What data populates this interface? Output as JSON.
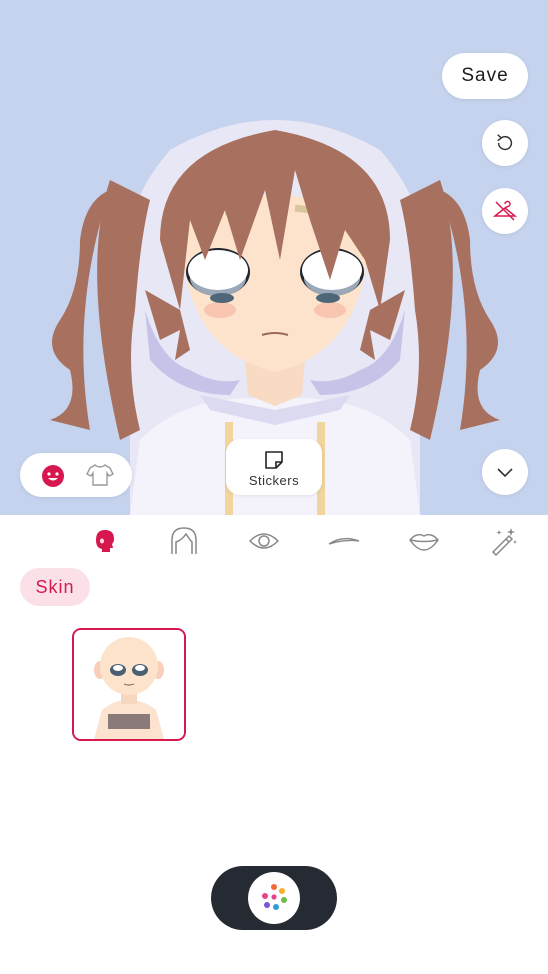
{
  "top_bar": {
    "save_label": "Save"
  },
  "preview": {
    "stickers_label": "Stickers",
    "mode_toggle": {
      "selected": "face",
      "options": [
        "face-icon",
        "shirt-icon"
      ]
    },
    "side_buttons": [
      "undo-icon",
      "hide-accessories-icon",
      "chevron-down-icon"
    ]
  },
  "category_tabs": [
    {
      "icon": "head-icon",
      "selected": true
    },
    {
      "icon": "hair-icon",
      "selected": false
    },
    {
      "icon": "eye-icon",
      "selected": false
    },
    {
      "icon": "eyebrow-icon",
      "selected": false
    },
    {
      "icon": "lips-icon",
      "selected": false
    },
    {
      "icon": "magic-wand-icon",
      "selected": false
    }
  ],
  "subcategory": {
    "label": "Skin"
  },
  "items": [
    {
      "name": "skin-option-1",
      "selected": true
    }
  ],
  "colors": {
    "accent": "#d6184f",
    "accent_light": "#fbe1e7",
    "dark_pill": "#262b33",
    "hair": "#a8705e",
    "skin": "#fde3cc"
  }
}
